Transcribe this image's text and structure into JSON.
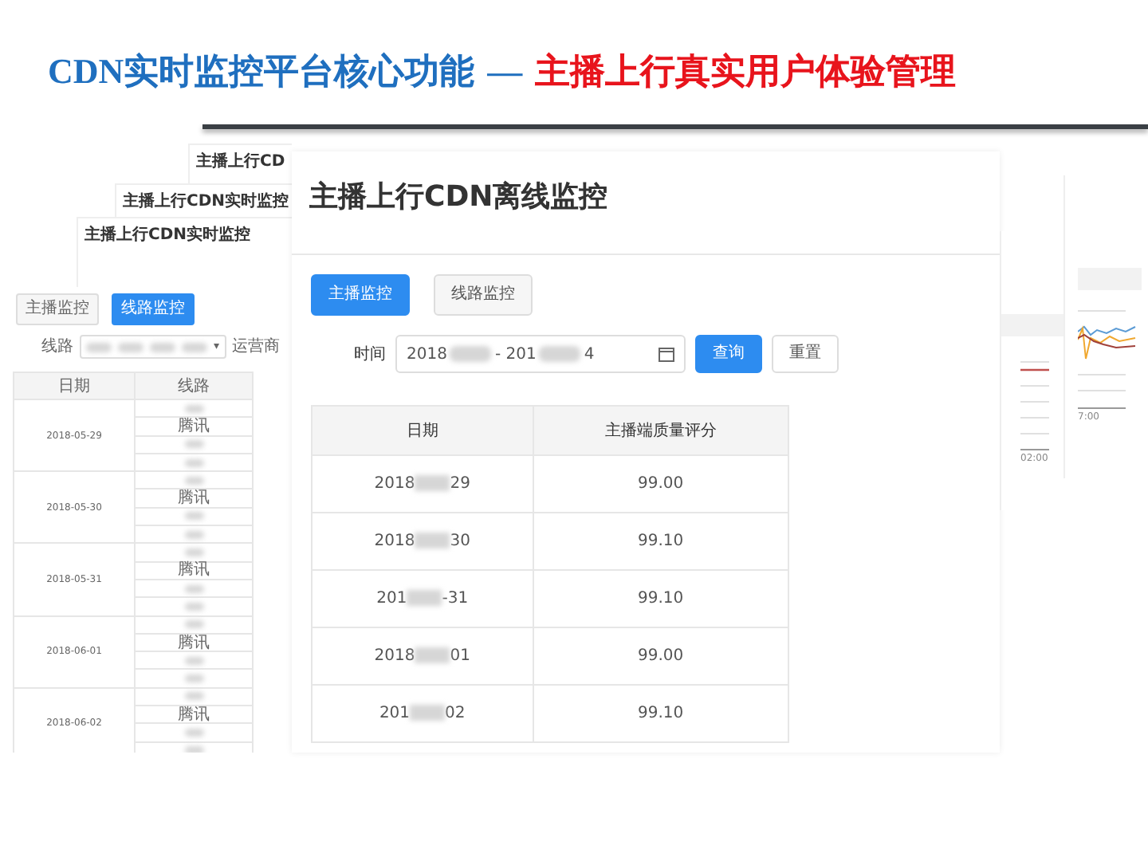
{
  "slide": {
    "title_lead": "CDN实时监控平台核心功能",
    "title_dash": "—",
    "title_topic": "主播上行真实用户体验管理"
  },
  "back_windows": [
    {
      "title": "主播上行CD"
    },
    {
      "title": "主播上行CDN实时监控"
    },
    {
      "title": "主播上行CDN实时监控"
    }
  ],
  "line_monitor": {
    "tabs": [
      {
        "label": "主播监控",
        "selected": false
      },
      {
        "label": "线路监控",
        "selected": true
      }
    ],
    "filter_label": "线路",
    "filter_tags": [
      {
        "kind": "blurred"
      },
      {
        "kind": "blurred"
      },
      {
        "kind": "blurred"
      },
      {
        "kind": "blurred"
      }
    ],
    "caret": "▾",
    "carrier_label": "运营商",
    "columns": [
      "日期",
      "线路"
    ],
    "groups": [
      {
        "date": "2018-05-29",
        "lines": [
          {
            "kind": "blurred"
          },
          {
            "kind": "text",
            "text": "腾讯"
          },
          {
            "kind": "blurred"
          },
          {
            "kind": "blurred"
          }
        ]
      },
      {
        "date": "2018-05-30",
        "lines": [
          {
            "kind": "blurred"
          },
          {
            "kind": "text",
            "text": "腾讯"
          },
          {
            "kind": "blurred"
          },
          {
            "kind": "blurred"
          }
        ]
      },
      {
        "date": "2018-05-31",
        "lines": [
          {
            "kind": "blurred"
          },
          {
            "kind": "text",
            "text": "腾讯"
          },
          {
            "kind": "blurred"
          },
          {
            "kind": "blurred"
          }
        ]
      },
      {
        "date": "2018-06-01",
        "lines": [
          {
            "kind": "blurred"
          },
          {
            "kind": "text",
            "text": "腾讯"
          },
          {
            "kind": "blurred"
          },
          {
            "kind": "blurred"
          }
        ]
      },
      {
        "date": "2018-06-02",
        "lines": [
          {
            "kind": "blurred"
          },
          {
            "kind": "text",
            "text": "腾讯"
          },
          {
            "kind": "blurred"
          },
          {
            "kind": "blurred"
          }
        ]
      }
    ]
  },
  "main": {
    "title": "主播上行CDN离线监控",
    "tabs": [
      {
        "label": "主播监控",
        "selected": true
      },
      {
        "label": "线路监控",
        "selected": false
      }
    ],
    "time_label": "时间",
    "date_range": [
      "2018",
      "- 201",
      "4"
    ],
    "buttons": [
      {
        "label": "查询",
        "kind": "primary"
      },
      {
        "label": "重置",
        "kind": "default"
      }
    ],
    "columns": [
      "日期",
      "主播端质量评分"
    ],
    "rows": [
      {
        "date": [
          "2018",
          "29"
        ],
        "score": "99.00"
      },
      {
        "date": [
          "2018",
          "30"
        ],
        "score": "99.10"
      },
      {
        "date": [
          "201",
          "-31"
        ],
        "score": "99.10"
      },
      {
        "date": [
          "2018",
          "01"
        ],
        "score": "99.00"
      },
      {
        "date": [
          "201",
          "02"
        ],
        "score": "99.10"
      }
    ]
  },
  "charts": [
    {
      "axis_label": "02:00"
    },
    {
      "axis_label": "7:00"
    }
  ]
}
